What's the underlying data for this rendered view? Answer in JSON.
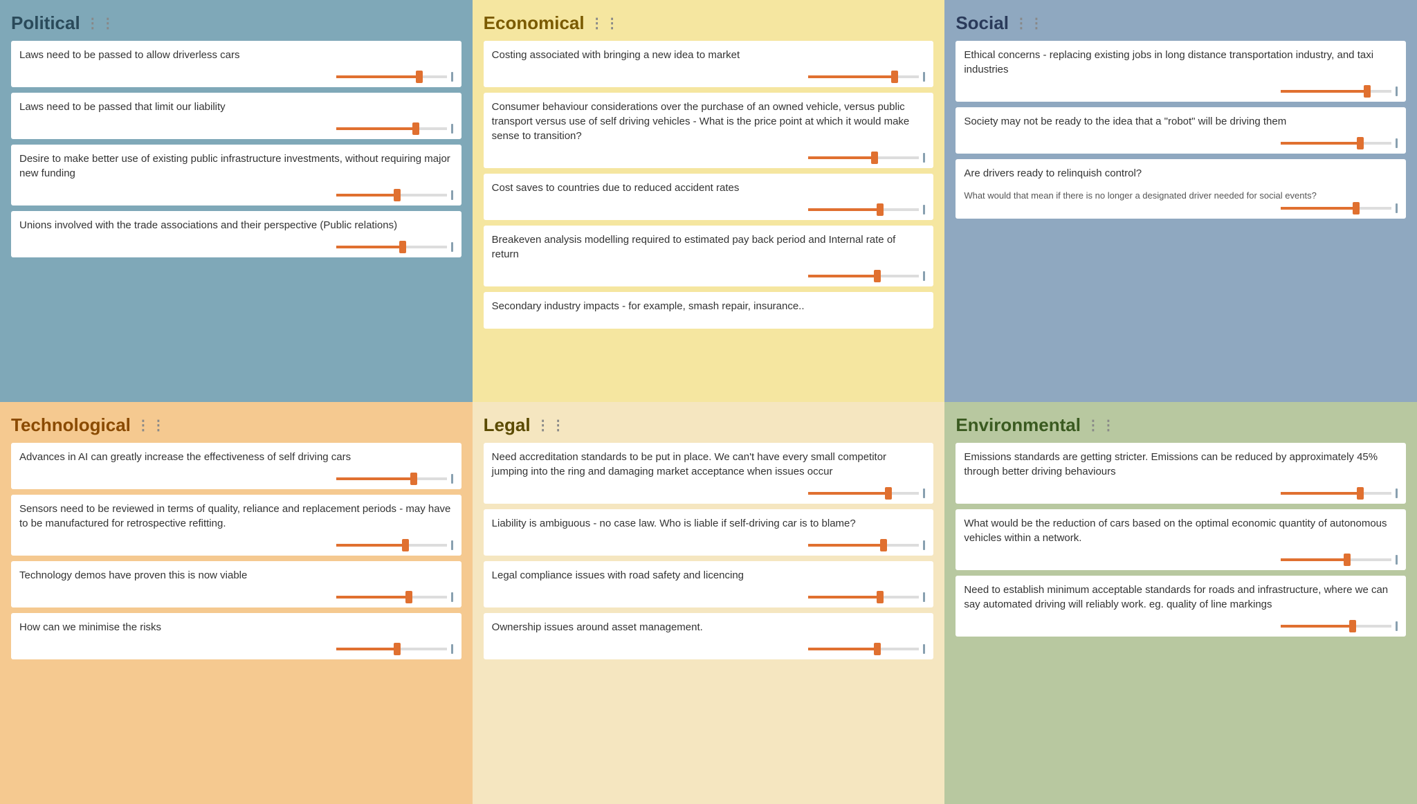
{
  "sections": {
    "political": {
      "title": "Political",
      "bg_class": "political",
      "cards": [
        {
          "text": "Laws need to be passed to allow driverless cars",
          "slider_pct": 75
        },
        {
          "text": "Laws need to be passed that limit our liability",
          "slider_pct": 72
        },
        {
          "text": "Desire to make better use of existing public infrastructure investments, without requiring major new funding",
          "slider_pct": 55
        },
        {
          "text": "Unions involved with the trade associations and their perspective (Public relations)",
          "slider_pct": 60
        }
      ]
    },
    "economical": {
      "title": "Economical",
      "bg_class": "economical",
      "cards": [
        {
          "text": "Costing associated with bringing a new idea to market",
          "slider_pct": 78
        },
        {
          "text": "Consumer behaviour considerations over the purchase of an owned vehicle, versus public transport versus use of self driving vehicles - What is the price point at which it would make sense to transition?",
          "slider_pct": 60
        },
        {
          "text": "Cost saves to countries due to reduced accident rates",
          "slider_pct": 65
        },
        {
          "text": "Breakeven analysis modelling required to estimated pay back period and Internal rate of return",
          "slider_pct": 62
        },
        {
          "text": "Secondary industry impacts - for example, smash repair, insurance..",
          "slider_pct": 0,
          "no_slider": true
        }
      ]
    },
    "social": {
      "title": "Social",
      "bg_class": "social",
      "cards": [
        {
          "text": "Ethical concerns - replacing existing jobs in long distance transportation industry, and taxi industries",
          "slider_pct": 78
        },
        {
          "text": "Society may not be ready to the idea that a \"robot\" will be driving them",
          "slider_pct": 72
        },
        {
          "text": "Are drivers ready to relinquish control?",
          "slider_pct": 68,
          "subtext": "What would that mean if there is no longer a designated driver needed for social events?"
        }
      ]
    },
    "technological": {
      "title": "Technological",
      "bg_class": "technological",
      "cards": [
        {
          "text": "Advances in AI can greatly increase the effectiveness of self driving cars",
          "slider_pct": 70
        },
        {
          "text": "Sensors need to be reviewed in terms of quality, reliance and replacement periods - may have to be manufactured for retrospective refitting.",
          "slider_pct": 63
        },
        {
          "text": "Technology demos have proven this is now viable",
          "slider_pct": 66
        },
        {
          "text": "How can we minimise the risks",
          "slider_pct": 55
        }
      ]
    },
    "legal": {
      "title": "Legal",
      "bg_class": "legal",
      "cards": [
        {
          "text": "Need accreditation standards to be put in place. We can't have every small competitor jumping into the ring and damaging market acceptance when issues occur",
          "slider_pct": 72
        },
        {
          "text": "Liability is ambiguous - no case law. Who is liable if self-driving car is to blame?",
          "slider_pct": 68
        },
        {
          "text": "Legal compliance issues with road safety and licencing",
          "slider_pct": 65
        },
        {
          "text": "Ownership issues around asset management.",
          "slider_pct": 62
        }
      ]
    },
    "environmental": {
      "title": "Environmental",
      "bg_class": "environmental",
      "cards": [
        {
          "text": "Emissions standards are getting stricter. Emissions can be reduced by approximately 45% through better driving behaviours",
          "slider_pct": 72
        },
        {
          "text": "What would be the reduction of cars based on the optimal economic quantity of autonomous vehicles within a network.",
          "slider_pct": 60
        },
        {
          "text": "Need to establish minimum acceptable standards for roads and infrastructure, where we can say automated driving will reliably work. eg. quality of line markings",
          "slider_pct": 65
        }
      ]
    }
  },
  "dots_label": "⋮⋮"
}
